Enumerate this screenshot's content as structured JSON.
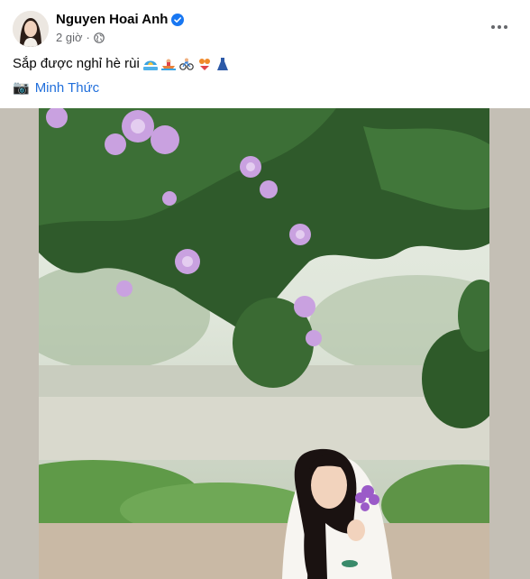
{
  "post": {
    "author": "Nguyen Hoai Anh",
    "time": "2 giờ",
    "caption": "Sắp được nghỉ hè rùi",
    "caption_emojis": [
      "beach-umbrella-icon",
      "rowboat-icon",
      "bicycle-icon",
      "bikini-icon",
      "dress-icon"
    ],
    "credit_icon": "📷",
    "credit_name": "Minh Thức"
  },
  "colors": {
    "link": "#216fdb",
    "secondary_text": "#65676b",
    "verified": "#1877f2",
    "photo_frame": "#c4bfb5"
  },
  "icons": {
    "verified": "verified-badge-icon",
    "privacy": "globe-icon",
    "more": "more-options-icon"
  }
}
